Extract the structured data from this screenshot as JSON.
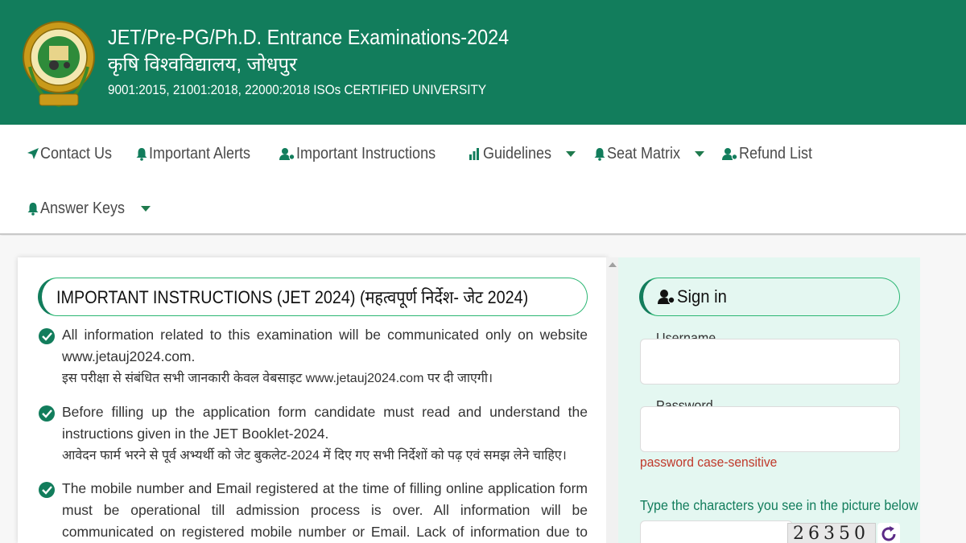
{
  "header": {
    "title": "JET/Pre-PG/Ph.D. Entrance Examinations-2024",
    "subtitle": "कृषि विश्वविद्यालय, जोधपुर",
    "iso": "9001:2015, 21001:2018, 22000:2018 ISOs CERTIFIED UNIVERSITY",
    "colors": {
      "primary": "#127d5c",
      "accent": "#2bb673"
    }
  },
  "nav": {
    "items": [
      {
        "label": "Contact Us",
        "icon": "send-icon",
        "dropdown": false
      },
      {
        "label": "Important Alerts",
        "icon": "bell-icon",
        "dropdown": false
      },
      {
        "label": "Important Instructions",
        "icon": "user-gear-icon",
        "dropdown": false
      },
      {
        "label": "Guidelines",
        "icon": "bar-chart-icon",
        "dropdown": true
      },
      {
        "label": "Seat Matrix",
        "icon": "bell-icon",
        "dropdown": true
      },
      {
        "label": "Refund List",
        "icon": "user-gear-icon",
        "dropdown": false
      },
      {
        "label": "Answer Keys",
        "icon": "bell-icon",
        "dropdown": true
      }
    ]
  },
  "instructions": {
    "title": "IMPORTANT INSTRUCTIONS (JET 2024) (महत्वपूर्ण निर्देश- जेट 2024)",
    "items": [
      {
        "en": "All information related to this examination will be communicated only on website www.jetauj2024.com.",
        "hi": "इस परीक्षा से संबंधित सभी जानकारी केवल वेबसाइट www.jetauj2024.com पर दी जाएगी।"
      },
      {
        "en": "Before filling up the application form candidate must read and understand the instructions given in the JET Booklet-2024.",
        "hi": "आवेदन फार्म भरने से पूर्व अभ्यर्थी को जेट बुकलेट-2024 में दिए गए सभी निर्देशों को पढ़ एवं समझ लेने चाहिए।"
      },
      {
        "en": "The mobile number and Email registered at the time of filling online application form must be operational till admission process is over. All information will be communicated on registered mobile number or Email. Lack of information due to change or block of registered mobile number",
        "hi": ""
      }
    ]
  },
  "signin": {
    "title": "Sign in",
    "username_label": "Username",
    "username_value": "",
    "password_label": "Password",
    "password_value": "",
    "password_note": "password case-sensitive",
    "captcha_label": "Type the characters you see in the picture below",
    "captcha_text": "26350",
    "captcha_value": ""
  }
}
